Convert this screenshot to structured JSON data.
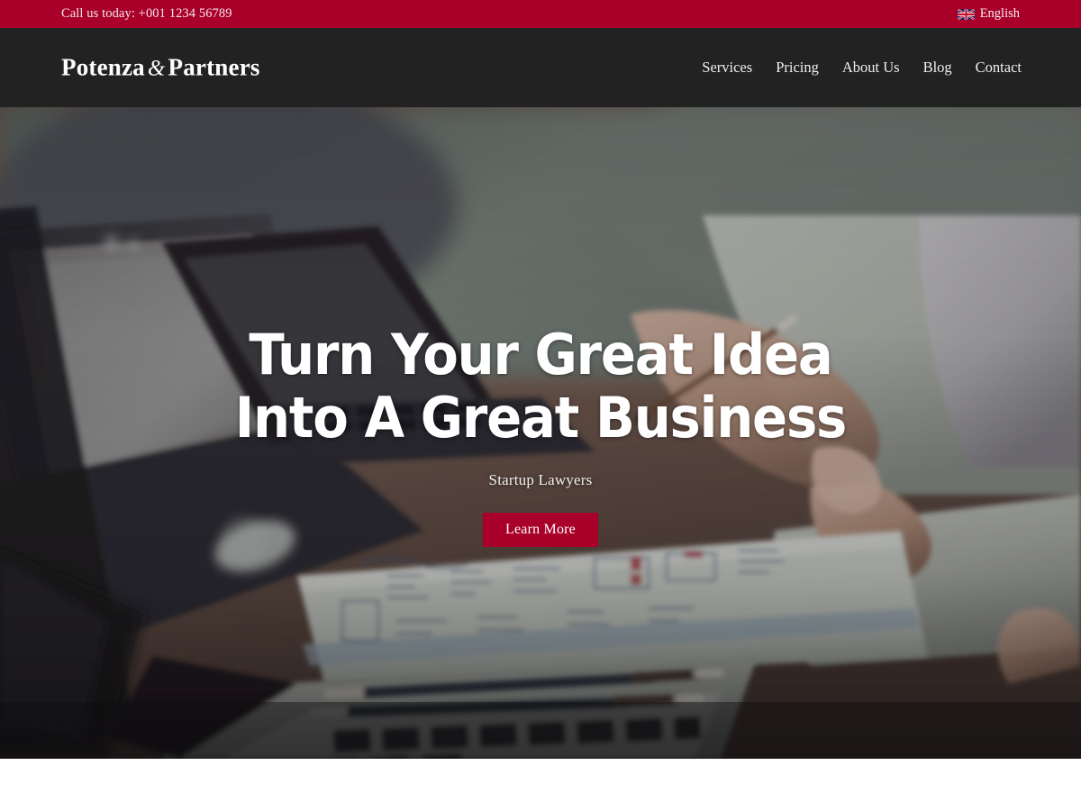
{
  "topbar": {
    "phone_text": "Call us today: +001 1234 56789",
    "language_label": "English",
    "flag_icon": "uk-flag-icon",
    "background_color": "#a90029",
    "text_color": "#f3e8ec"
  },
  "navbar": {
    "background_color": "#222222",
    "logo": {
      "word_one": "Potenza",
      "ampersand": "&",
      "word_two": "Partners"
    },
    "links": [
      {
        "label": "Services"
      },
      {
        "label": "Pricing"
      },
      {
        "label": "About Us"
      },
      {
        "label": "Blog"
      },
      {
        "label": "Contact"
      }
    ]
  },
  "hero": {
    "title": "Turn Your Great Idea Into A Great Business",
    "subtitle": "Startup Lawyers",
    "cta_label": "Learn More",
    "cta_color": "#a90029",
    "title_color": "#ffffff",
    "image_description": "Two people at a wooden desk with laptops, a notebook with hand-drawn diagrams, pens and a person writing"
  }
}
